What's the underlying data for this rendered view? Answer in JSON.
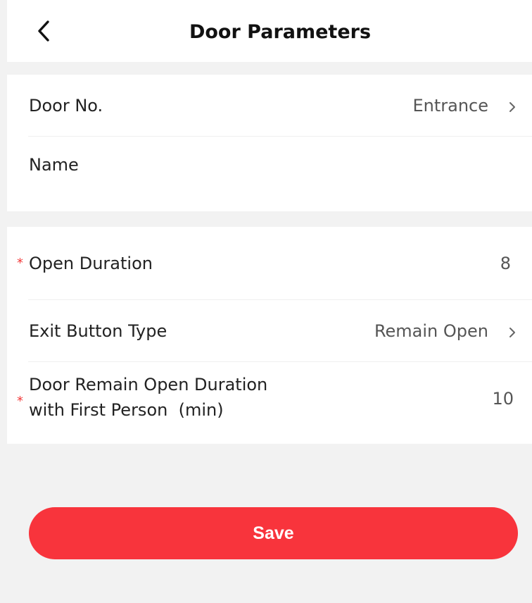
{
  "header": {
    "title": "Door Parameters",
    "back_icon": "chevron-left-icon"
  },
  "section1": {
    "door_no": {
      "label": "Door No.",
      "value": "Entrance"
    },
    "name": {
      "label": "Name",
      "value": ""
    }
  },
  "section2": {
    "open_duration": {
      "label": "Open Duration",
      "value": "8",
      "required": "*"
    },
    "exit_button_type": {
      "label": "Exit Button Type",
      "value": "Remain Open"
    },
    "first_person": {
      "label_line1": "Door Remain Open Duration",
      "label_line2": "with First Person  (min)",
      "value": "10",
      "required": "*"
    }
  },
  "actions": {
    "save_label": "Save"
  },
  "colors": {
    "accent": "#f8343c",
    "required": "#f23a3a",
    "background": "#f2f2f2"
  }
}
